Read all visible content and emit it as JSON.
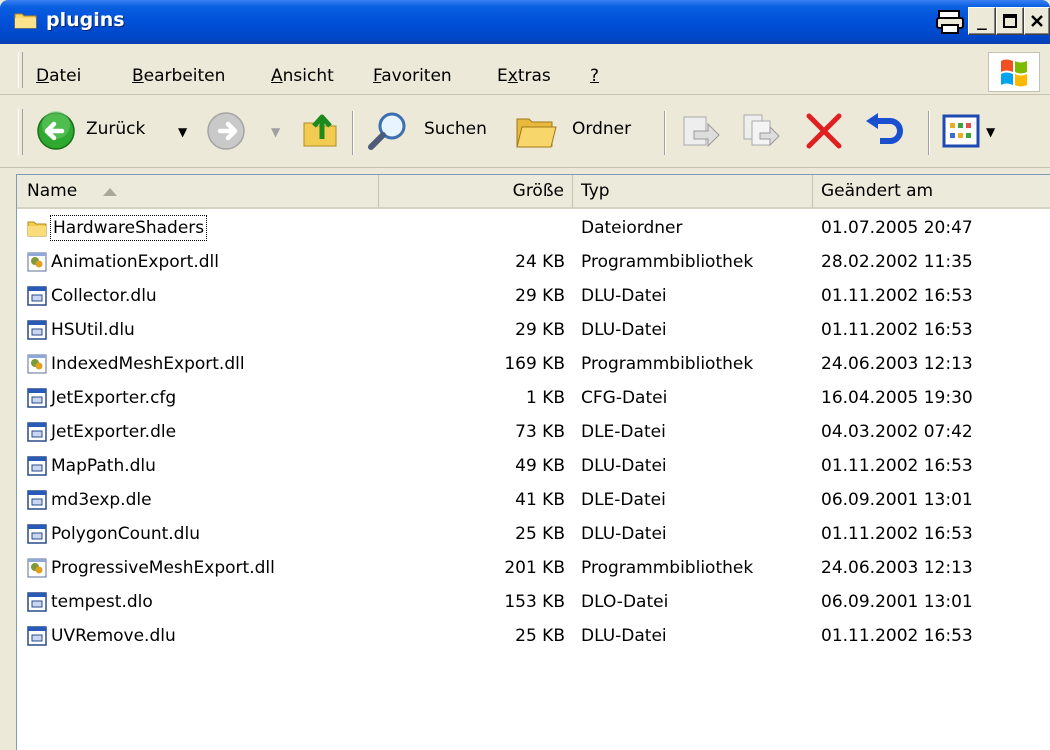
{
  "window": {
    "title": "plugins"
  },
  "menu": {
    "items": [
      {
        "label": "Datei",
        "accel": "D"
      },
      {
        "label": "Bearbeiten",
        "accel": "B"
      },
      {
        "label": "Ansicht",
        "accel": "A"
      },
      {
        "label": "Favoriten",
        "accel": "F"
      },
      {
        "label": "Extras",
        "accel": "x"
      },
      {
        "label": "?",
        "accel": "?"
      }
    ]
  },
  "toolbar": {
    "back_label": "Zurück",
    "search_label": "Suchen",
    "folders_label": "Ordner"
  },
  "columns": {
    "name": "Name",
    "size": "Größe",
    "type": "Typ",
    "modified": "Geändert am"
  },
  "files": [
    {
      "name": "HardwareShaders",
      "size": "",
      "type": "Dateiordner",
      "modified": "01.07.2005 20:47",
      "icon": "folder-icon"
    },
    {
      "name": "AnimationExport.dll",
      "size": "24 KB",
      "type": "Programmbibliothek",
      "modified": "28.02.2002 11:35",
      "icon": "dll-icon"
    },
    {
      "name": "Collector.dlu",
      "size": "29 KB",
      "type": "DLU-Datei",
      "modified": "01.11.2002 16:53",
      "icon": "file-icon"
    },
    {
      "name": "HSUtil.dlu",
      "size": "29 KB",
      "type": "DLU-Datei",
      "modified": "01.11.2002 16:53",
      "icon": "file-icon"
    },
    {
      "name": "IndexedMeshExport.dll",
      "size": "169 KB",
      "type": "Programmbibliothek",
      "modified": "24.06.2003 12:13",
      "icon": "dll-icon"
    },
    {
      "name": "JetExporter.cfg",
      "size": "1 KB",
      "type": "CFG-Datei",
      "modified": "16.04.2005 19:30",
      "icon": "file-icon"
    },
    {
      "name": "JetExporter.dle",
      "size": "73 KB",
      "type": "DLE-Datei",
      "modified": "04.03.2002 07:42",
      "icon": "file-icon"
    },
    {
      "name": "MapPath.dlu",
      "size": "49 KB",
      "type": "DLU-Datei",
      "modified": "01.11.2002 16:53",
      "icon": "file-icon"
    },
    {
      "name": "md3exp.dle",
      "size": "41 KB",
      "type": "DLE-Datei",
      "modified": "06.09.2001 13:01",
      "icon": "file-icon"
    },
    {
      "name": "PolygonCount.dlu",
      "size": "25 KB",
      "type": "DLU-Datei",
      "modified": "01.11.2002 16:53",
      "icon": "file-icon"
    },
    {
      "name": "ProgressiveMeshExport.dll",
      "size": "201 KB",
      "type": "Programmbibliothek",
      "modified": "24.06.2003 12:13",
      "icon": "dll-icon"
    },
    {
      "name": "tempest.dlo",
      "size": "153 KB",
      "type": "DLO-Datei",
      "modified": "06.09.2001 13:01",
      "icon": "file-icon"
    },
    {
      "name": "UVRemove.dlu",
      "size": "25 KB",
      "type": "DLU-Datei",
      "modified": "01.11.2002 16:53",
      "icon": "file-icon"
    }
  ],
  "colors": {
    "titlebar": "#0050d8",
    "face": "#ece9d8",
    "close": "#e81123"
  }
}
